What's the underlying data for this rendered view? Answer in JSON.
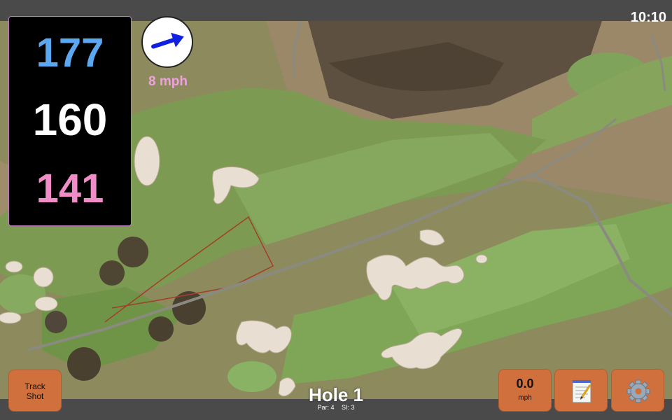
{
  "status": {
    "time": "10:10"
  },
  "yardage": {
    "back": "177",
    "center": "160",
    "front": "141"
  },
  "wind": {
    "speed": "8 mph",
    "icon": "wind-arrow-icon"
  },
  "buttons": {
    "track_shot": "Track\nShot",
    "speed_value": "0.0",
    "speed_unit": "mph",
    "notes_icon": "notepad-icon",
    "settings_icon": "gear-icon"
  },
  "hole": {
    "title": "Hole 1",
    "par": "Par: 4",
    "si": "SI: 3"
  },
  "colors": {
    "back": "#5ba8f0",
    "center": "#ffffff",
    "front": "#f08cc8",
    "button": "#d0703c"
  }
}
